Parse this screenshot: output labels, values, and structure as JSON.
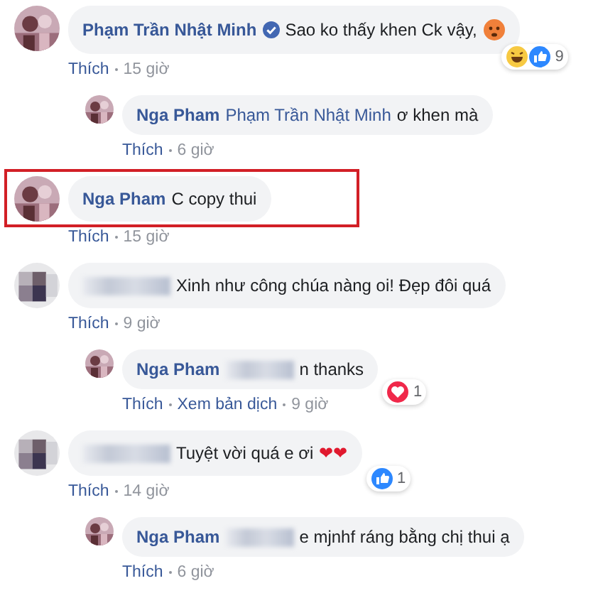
{
  "comments": [
    {
      "kind": "comment",
      "avatar": {
        "kind": "picture",
        "blurred": false
      },
      "author": "Phạm Trần Nhật Minh",
      "verified": true,
      "name_redacted": false,
      "text": "Sao ko thấy khen Ck vậy,",
      "icons": [
        {
          "kind": "face"
        }
      ],
      "highlighted": false,
      "reactions": [
        {
          "kind": "haha"
        },
        {
          "kind": "like"
        }
      ],
      "reaction_count": "9",
      "actions": [
        "Thích",
        "15 giờ"
      ]
    },
    {
      "kind": "reply",
      "avatar": {
        "kind": "picture",
        "blurred": false
      },
      "author": "Nga Pham",
      "verified": false,
      "name_redacted": false,
      "mention": "Phạm Trần Nhật Minh",
      "text": "ơ khen mà",
      "highlighted": false,
      "actions": [
        "Thích",
        "6 giờ"
      ]
    },
    {
      "kind": "comment",
      "avatar": {
        "kind": "picture",
        "blurred": false
      },
      "author": "Nga Pham",
      "verified": false,
      "name_redacted": false,
      "text": "C copy thui",
      "highlighted": true,
      "actions": [
        "Thích",
        "15 giờ"
      ]
    },
    {
      "kind": "comment",
      "avatar": {
        "kind": "picture",
        "blurred": true
      },
      "verified": false,
      "name_redacted": true,
      "text": "Xinh như công chúa nàng oi! Đẹp đôi quá",
      "highlighted": false,
      "actions": [
        "Thích",
        "9 giờ"
      ]
    },
    {
      "kind": "reply",
      "avatar": {
        "kind": "picture",
        "blurred": false
      },
      "author": "Nga Pham",
      "verified": false,
      "name_redacted": true,
      "text": "n thanks",
      "highlighted": false,
      "reactions": [
        {
          "kind": "love"
        }
      ],
      "reaction_count": "1",
      "actions": [
        "Thích",
        "Xem bản dịch",
        "9 giờ"
      ]
    },
    {
      "kind": "comment",
      "avatar": {
        "kind": "picture",
        "blurred": true
      },
      "verified": false,
      "name_redacted": true,
      "text": "Tuyệt vời quá e ơi",
      "emoji": "❤❤",
      "highlighted": false,
      "reactions": [
        {
          "kind": "like"
        }
      ],
      "reaction_count": "1",
      "actions": [
        "Thích",
        "14 giờ"
      ]
    },
    {
      "kind": "reply",
      "avatar": {
        "kind": "picture",
        "blurred": false
      },
      "author": "Nga Pham",
      "verified": false,
      "name_redacted": true,
      "text": "e mjnhf ráng bằng chị thui ạ",
      "highlighted": false,
      "actions": [
        "Thích",
        "6 giờ"
      ]
    }
  ]
}
